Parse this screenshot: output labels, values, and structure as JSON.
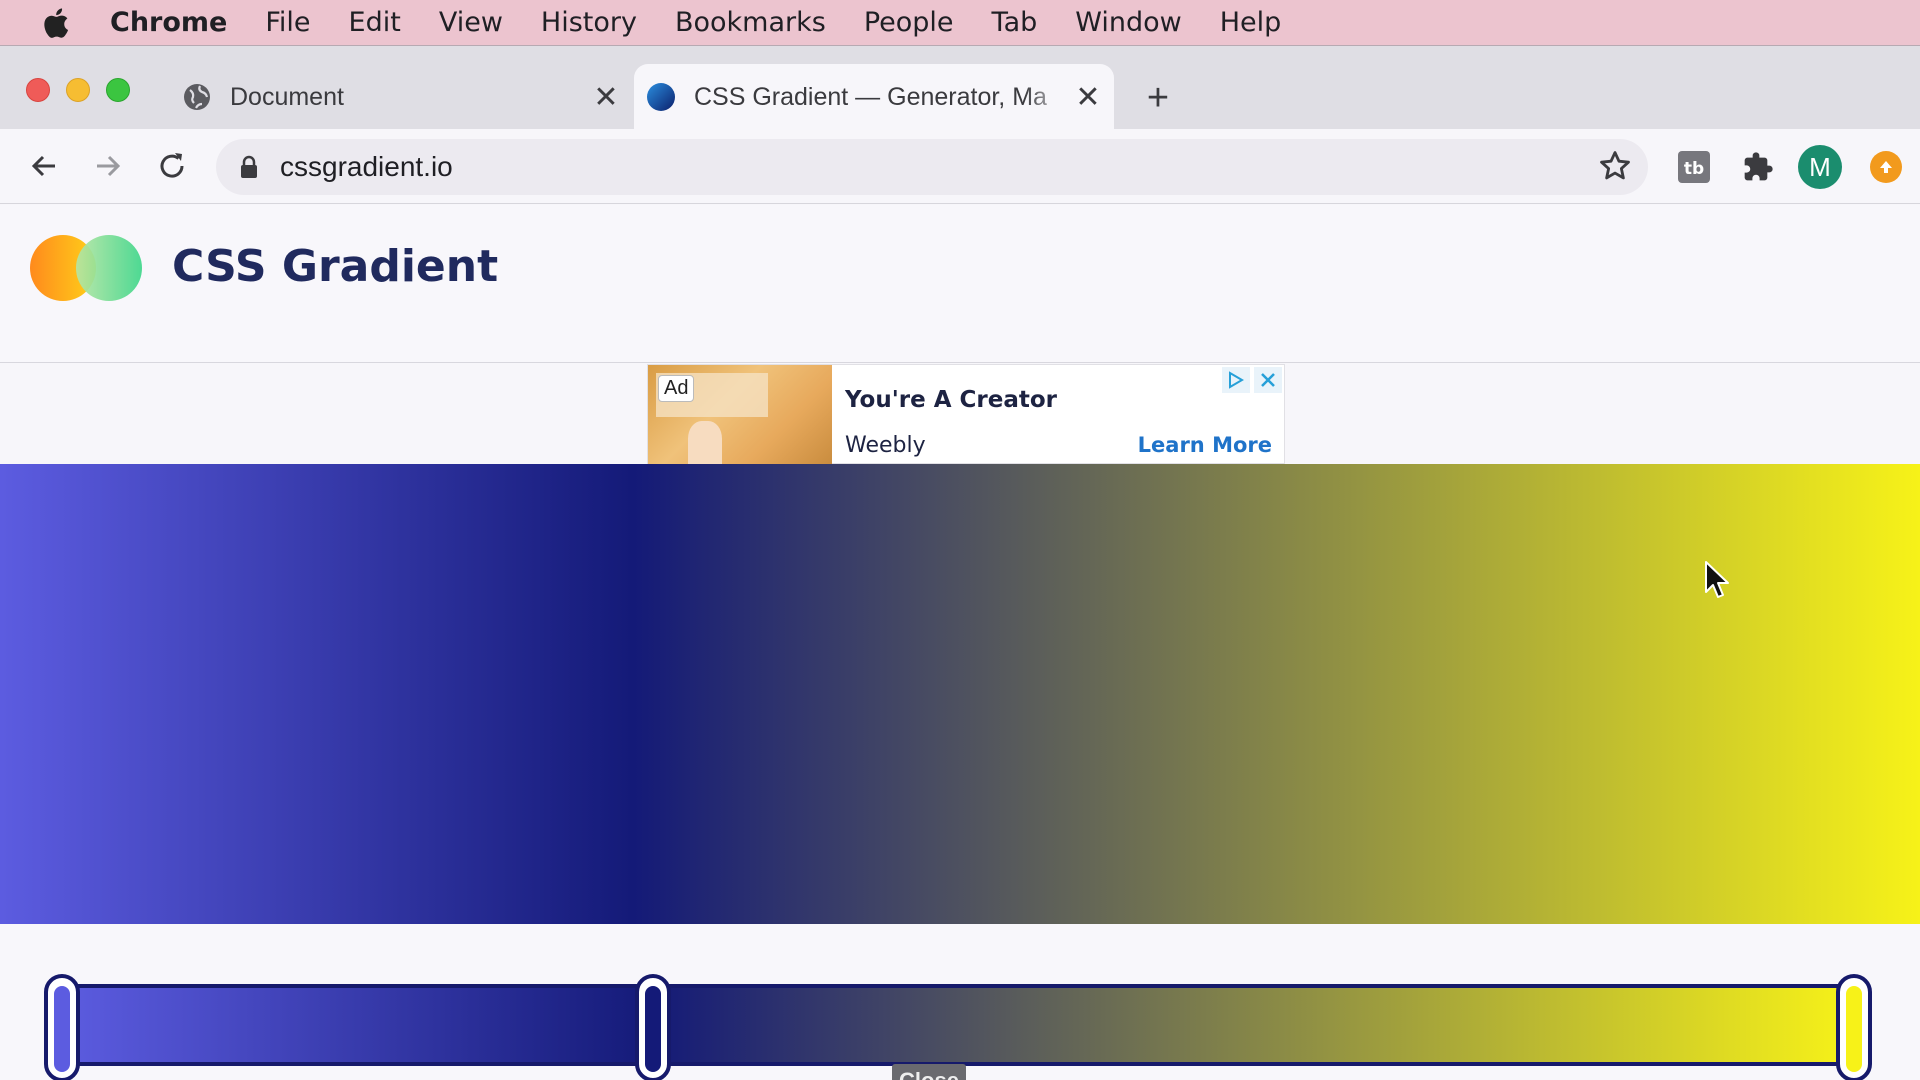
{
  "menubar": {
    "app": "Chrome",
    "items": [
      "File",
      "Edit",
      "View",
      "History",
      "Bookmarks",
      "People",
      "Tab",
      "Window",
      "Help"
    ]
  },
  "tabs": [
    {
      "title": "Document",
      "icon": "globe-icon",
      "active": false
    },
    {
      "title": "CSS Gradient — Generator, Ma",
      "icon": "cssgradient-favicon",
      "active": true
    }
  ],
  "toolbar": {
    "url": "cssgradient.io",
    "profile_initial": "M"
  },
  "site": {
    "title": "CSS Gradient"
  },
  "ad": {
    "badge": "Ad",
    "headline": "You're A Creator",
    "brand": "Weebly",
    "cta": "Learn More"
  },
  "gradient": {
    "stops": [
      {
        "color": "#5c5ce0",
        "position": 0
      },
      {
        "color": "#141a78",
        "position": 33
      },
      {
        "color": "#f7f218",
        "position": 100
      }
    ]
  },
  "tooltip": {
    "label": "Close"
  },
  "colors": {
    "menubar_bg": "#ecc4cf",
    "title_color": "#202a5e",
    "link_color": "#1f73c9",
    "avatar_bg": "#1b8d6e"
  }
}
